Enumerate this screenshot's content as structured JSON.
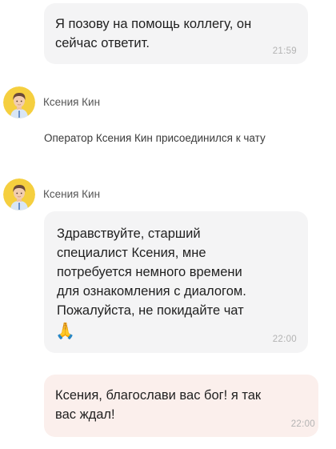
{
  "messages": [
    {
      "sender": "operator",
      "text": "Я позову на помощь коллегу, он\nсейчас ответит.",
      "time": "21:59"
    },
    {
      "sender": "operator",
      "agent_name": "Ксения Кин",
      "text": "Здравствуйте, старший\nспециалист Ксения, мне\nпотребуется немного времени\nдля ознакомления с диалогом.\nПожалуйста, не покидайте чат",
      "emoji": "🙏",
      "time": "22:00"
    },
    {
      "sender": "user",
      "text": "Ксения, благослави вас бог! я так\nвас ждал!",
      "time": "22:00"
    }
  ],
  "agent_header_1": {
    "name": "Ксения Кин"
  },
  "system_message": {
    "text": "Оператор Ксения Кин присоединился к чату"
  },
  "colors": {
    "operator_bubble": "#f4f4f5",
    "user_bubble": "#fbefec",
    "avatar_bg": "#f5cf3f"
  }
}
